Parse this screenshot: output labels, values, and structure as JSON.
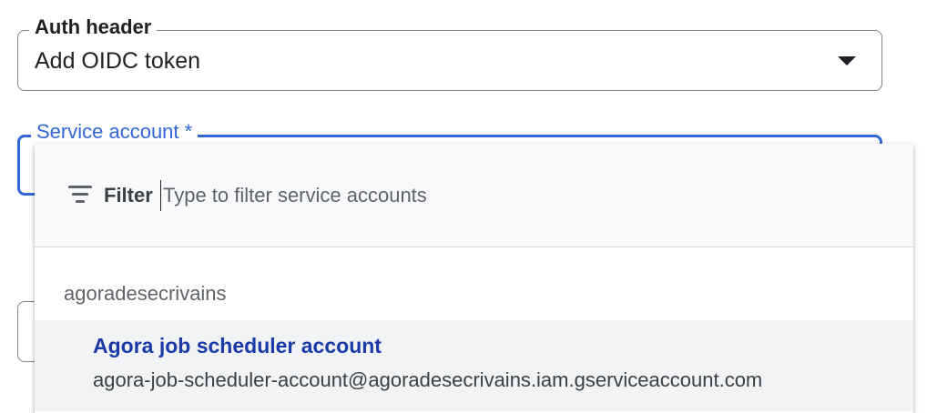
{
  "auth_header": {
    "label": "Auth header",
    "value": "Add OIDC token",
    "icon": "dropdown-arrow-icon"
  },
  "service_account": {
    "label": "Service account *",
    "focus_color": "#3367d6"
  },
  "dropdown": {
    "filter": {
      "icon": "filter-icon",
      "label": "Filter",
      "placeholder": "Type to filter service accounts",
      "value": ""
    },
    "group": {
      "name": "agoradesecrivains"
    },
    "options": [
      {
        "title": "Agora job scheduler account",
        "email": "agora-job-scheduler-account@agoradesecrivains.iam.gserviceaccount.com"
      }
    ]
  },
  "colors": {
    "accent": "#3367d6",
    "option_title": "#1a3aa8",
    "highlight_bg": "#f1f3f4"
  }
}
